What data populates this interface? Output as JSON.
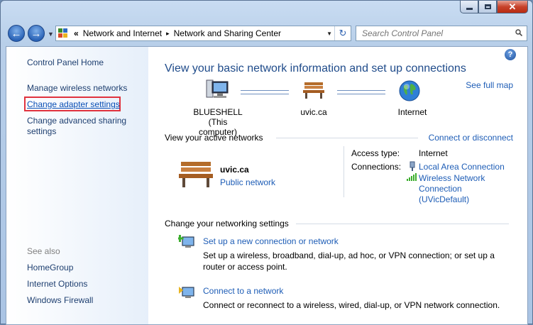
{
  "window": {
    "caption_buttons": {
      "minimize": "minimize",
      "maximize": "maximize",
      "close": "✕"
    }
  },
  "address": {
    "overflow": "«",
    "crumbs": [
      "Network and Internet",
      "Network and Sharing Center"
    ],
    "separator": "▸",
    "search_placeholder": "Search Control Panel"
  },
  "sidebar": {
    "home": "Control Panel Home",
    "links": [
      "Manage wireless networks",
      "Change adapter settings",
      "Change advanced sharing settings"
    ],
    "see_also_heading": "See also",
    "see_also": [
      "HomeGroup",
      "Internet Options",
      "Windows Firewall"
    ]
  },
  "main": {
    "title": "View your basic network information and set up connections",
    "see_full_map": "See full map",
    "help": "?",
    "map_nodes": [
      {
        "name": "BLUESHELL",
        "sub": "(This computer)",
        "icon": "computer-icon"
      },
      {
        "name": "uvic.ca",
        "sub": "",
        "icon": "bench-icon"
      },
      {
        "name": "Internet",
        "sub": "",
        "icon": "globe-icon"
      }
    ],
    "active_networks": {
      "heading": "View your active networks",
      "action": "Connect or disconnect",
      "network_name": "uvic.ca",
      "network_type": "Public network",
      "access_type_label": "Access type:",
      "access_type_value": "Internet",
      "connections_label": "Connections:",
      "connection_1": "Local Area Connection",
      "connection_2_line1": "Wireless Network",
      "connection_2_line2": "Connection",
      "connection_2_line3": "(UVicDefault)"
    },
    "settings": {
      "heading": "Change your networking settings",
      "tasks": [
        {
          "link": "Set up a new connection or network",
          "desc_line1": "Set up a wireless, broadband, dial-up, ad hoc, or VPN connection; or set up a",
          "desc_line2": "router or access point."
        },
        {
          "link": "Connect to a network",
          "desc_line1": "Connect or reconnect to a wireless, wired, dial-up, or VPN network connection.",
          "desc_line2": ""
        }
      ]
    }
  }
}
